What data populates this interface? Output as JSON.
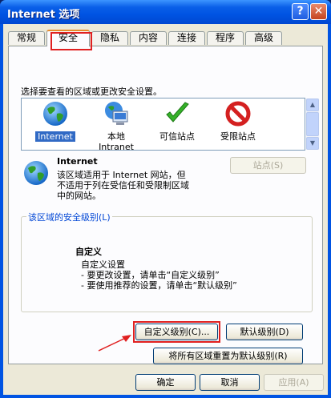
{
  "window": {
    "title": "Internet 选项",
    "help_glyph": "?",
    "close_glyph": "✕"
  },
  "tabs": [
    {
      "label": "常规"
    },
    {
      "label": "安全",
      "active": true
    },
    {
      "label": "隐私"
    },
    {
      "label": "内容"
    },
    {
      "label": "连接"
    },
    {
      "label": "程序"
    },
    {
      "label": "高级"
    }
  ],
  "security": {
    "instruction": "选择要查看的区域或更改安全设置。",
    "zones": [
      {
        "label": "Internet",
        "icon": "globe-icon",
        "selected": true
      },
      {
        "label": "本地\nIntranet",
        "icon": "local-intranet-icon"
      },
      {
        "label": "可信站点",
        "icon": "trusted-check-icon"
      },
      {
        "label": "受限站点",
        "icon": "restricted-no-icon"
      }
    ],
    "zone_name": "Internet",
    "zone_description": "该区域适用于 Internet 网站，但\n不适用于列在受信任和受限制区域\n中的网站。",
    "sites_button": "站点(S)",
    "level_group_title": "该区域的安全级别(L)",
    "level_title": "自定义",
    "level_lines": [
      "自定义设置",
      "- 要更改设置，请单击“自定义级别”",
      "- 要使用推荐的设置，请单击“默认级别”"
    ],
    "custom_level_button": "自定义级别(C)...",
    "default_level_button": "默认级别(D)",
    "reset_all_button": "将所有区域重置为默认级别(R)"
  },
  "footer": {
    "ok": "确定",
    "cancel": "取消",
    "apply": "应用(A)"
  },
  "colors": {
    "annotation": "#e02020",
    "titlebar": "#0054e3",
    "selection": "#316ac5"
  }
}
